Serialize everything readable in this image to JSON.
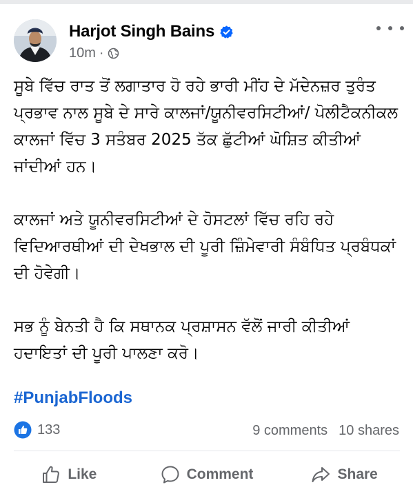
{
  "post": {
    "author": "Harjot Singh Bains",
    "time": "10m",
    "separator": "·",
    "paragraphs": [
      "ਸੂਬੇ ਵਿੱਚ ਰਾਤ ਤੋਂ ਲਗਾਤਾਰ ਹੋ ਰਹੇ ਭਾਰੀ ਮੀਂਹ ਦੇ ਮੱਦੇਨਜ਼ਰ ਤੁਰੰਤ ਪ੍ਰਭਾਵ ਨਾਲ ਸੂਬੇ ਦੇ ਸਾਰੇ ਕਾਲਜਾਂ/ਯੂਨੀਵਰਸਿਟੀਆਂ/ ਪੋਲੀਟੈਕਨੀਕਲ ਕਾਲਜਾਂ ਵਿੱਚ 3 ਸਤੰਬਰ 2025 ਤੱਕ ਛੁੱਟੀਆਂ ਘੋਸ਼ਿਤ ਕੀਤੀਆਂ ਜਾਂਦੀਆਂ ਹਨ।",
      "ਕਾਲਜਾਂ ਅਤੇ ਯੂਨੀਵਰਸਿਟੀਆਂ ਦੇ ਹੋਸਟਲਾਂ ਵਿੱਚ ਰਹਿ ਰਹੇ ਵਿਦਿਆਰਥੀਆਂ ਦੀ ਦੇਖਭਾਲ ਦੀ ਪੂਰੀ ਜ਼ਿੰਮੇਵਾਰੀ ਸੰਬੰਧਿਤ ਪ੍ਰਬੰਧਕਾਂ ਦੀ ਹੋਵੇਗੀ।",
      "ਸਭ ਨੂੰ ਬੇਨਤੀ ਹੈ ਕਿ ਸਥਾਨਕ ਪ੍ਰਸ਼ਾਸਨ ਵੱਲੋਂ ਜਾਰੀ ਕੀਤੀਆਂ ਹਦਾਇਤਾਂ ਦੀ ਪੂਰੀ ਪਾਲਣਾ ਕਰੋ।"
    ],
    "hashtag": "#PunjabFloods"
  },
  "engagement": {
    "reactions": "133",
    "comments": "9 comments",
    "shares": "10 shares"
  },
  "actions": {
    "like": "Like",
    "comment": "Comment",
    "share": "Share"
  },
  "icons": {
    "verified": "verified-badge-icon",
    "audience": "globe-icon",
    "more": "more-options-icon",
    "reaction": "like-reaction-icon",
    "like": "thumbs-up-icon",
    "comment": "comment-bubble-icon",
    "share": "share-arrow-icon"
  },
  "colors": {
    "brand_blue": "#1b66d2",
    "secondary_text": "#65676b",
    "verified": "#0866ff"
  }
}
